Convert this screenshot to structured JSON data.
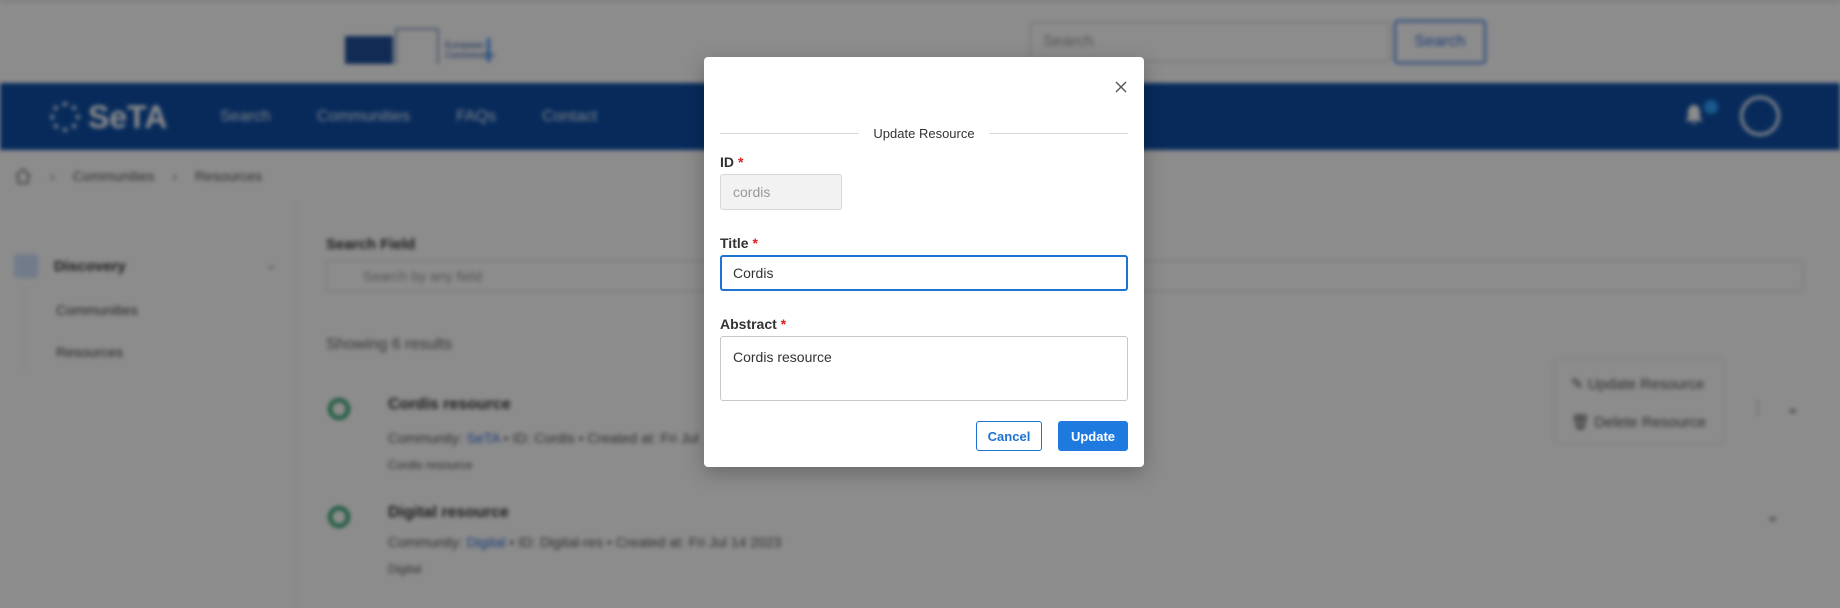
{
  "header": {
    "logo_text": "European Commission",
    "search_placeholder": "Search",
    "search_button": "Search"
  },
  "navbar": {
    "brand": "SeTA",
    "links": [
      "Search",
      "Communities",
      "FAQs",
      "Contact"
    ]
  },
  "breadcrumb": [
    "Communities",
    "Resources"
  ],
  "sidebar": {
    "group_label": "Discovery",
    "items": [
      "Communities",
      "Resources"
    ]
  },
  "main": {
    "search_field_label": "Search Field",
    "search_field_placeholder": "Search by any field",
    "results_count": "Showing 6 results",
    "results": [
      {
        "title": "Cordis resource",
        "community_label": "Community:",
        "community": "SeTA",
        "rest": "• ID: Cordis • Created at: Fri Jul",
        "desc": "Cordis resource"
      },
      {
        "title": "Digital resource",
        "community_label": "Community:",
        "community": "Digital",
        "rest": "• ID: Digital-res • Created at: Fri Jul 14 2023",
        "desc": "Digital"
      }
    ],
    "context_menu": [
      "Update Resource",
      "Delete Resource"
    ]
  },
  "modal": {
    "title": "Update Resource",
    "id_label": "ID",
    "id_value": "cordis",
    "title_label": "Title",
    "title_value": "Cordis",
    "abstract_label": "Abstract",
    "abstract_value": "Cordis resource",
    "required_mark": "*",
    "cancel_label": "Cancel",
    "update_label": "Update"
  },
  "colors": {
    "navbar": "#0d4ea6",
    "primary": "#1f7ae0",
    "required": "#e02020"
  }
}
